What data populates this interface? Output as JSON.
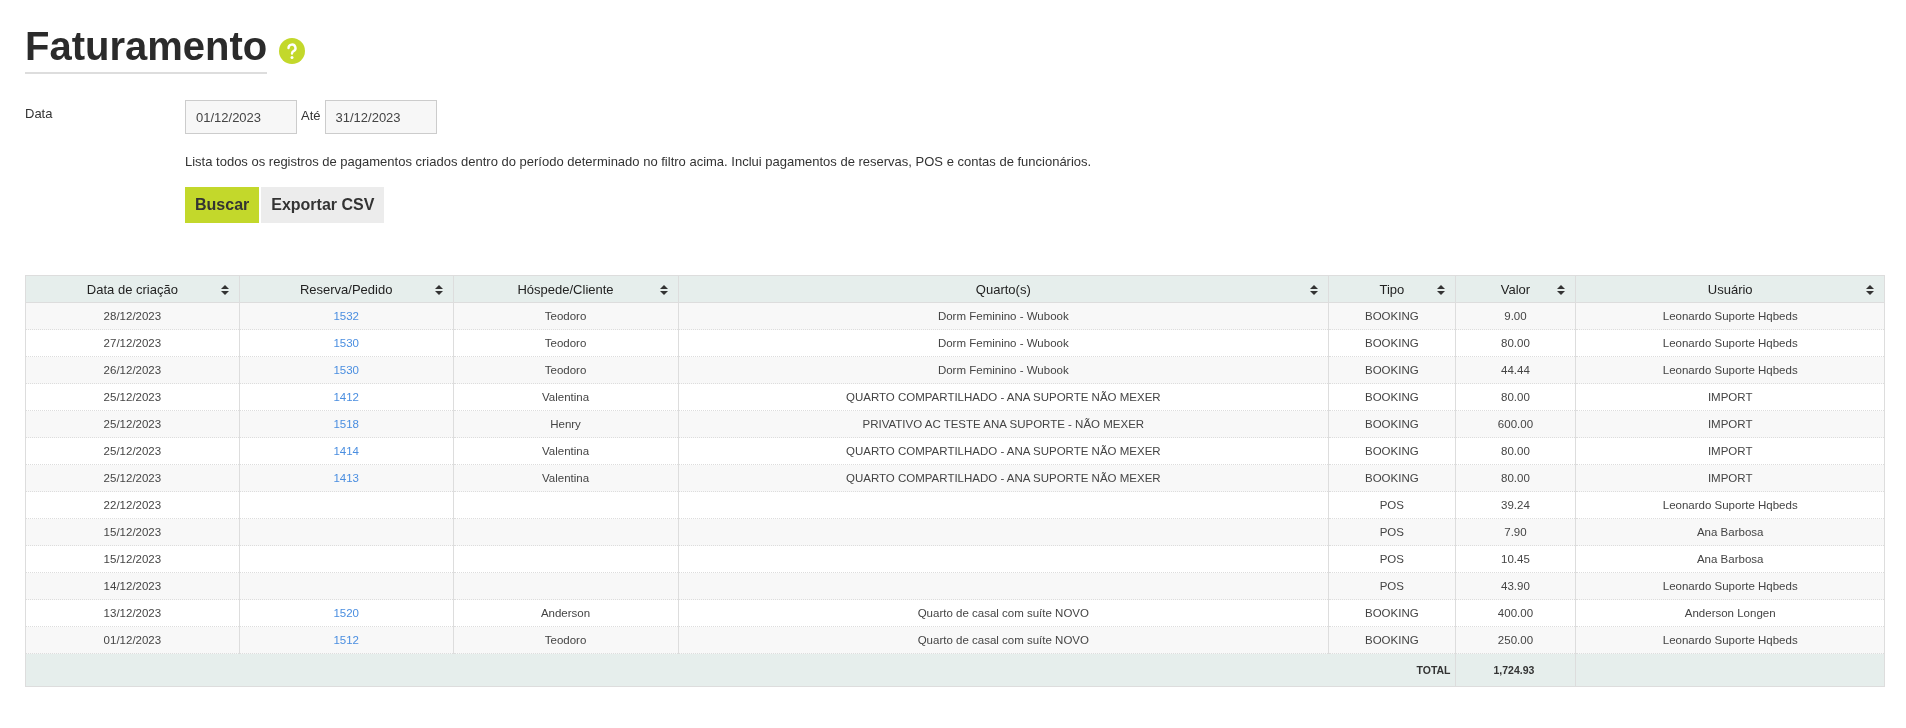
{
  "title": "Faturamento",
  "filter": {
    "label": "Data",
    "from": "01/12/2023",
    "to_label": "Até",
    "to": "31/12/2023"
  },
  "description": "Lista todos os registros de pagamentos criados dentro do período determinado no filtro acima. Inclui pagamentos de reservas, POS e contas de funcionários.",
  "buttons": [
    {
      "label": "Buscar",
      "kind": "primary"
    },
    {
      "label": "Exportar CSV",
      "kind": "secondary"
    }
  ],
  "table": {
    "columns": [
      {
        "label": "Data de criação",
        "sortable": true
      },
      {
        "label": "Reserva/Pedido",
        "sortable": true
      },
      {
        "label": "Hóspede/Cliente",
        "sortable": true
      },
      {
        "label": "Quarto(s)",
        "sortable": true
      },
      {
        "label": "Tipo",
        "sortable": true
      },
      {
        "label": "Valor",
        "sortable": true
      },
      {
        "label": "Usuário",
        "sortable": true
      }
    ],
    "rows": [
      {
        "date": "28/12/2023",
        "order": "1532",
        "guest": "Teodoro",
        "room": "Dorm Feminino - Wubook",
        "type": "BOOKING",
        "value": "9.00",
        "user": "Leonardo Suporte Hqbeds"
      },
      {
        "date": "27/12/2023",
        "order": "1530",
        "guest": "Teodoro",
        "room": "Dorm Feminino - Wubook",
        "type": "BOOKING",
        "value": "80.00",
        "user": "Leonardo Suporte Hqbeds"
      },
      {
        "date": "26/12/2023",
        "order": "1530",
        "guest": "Teodoro",
        "room": "Dorm Feminino - Wubook",
        "type": "BOOKING",
        "value": "44.44",
        "user": "Leonardo Suporte Hqbeds"
      },
      {
        "date": "25/12/2023",
        "order": "1412",
        "guest": "Valentina",
        "room": "QUARTO COMPARTILHADO - ANA SUPORTE NÃO MEXER",
        "type": "BOOKING",
        "value": "80.00",
        "user": "IMPORT"
      },
      {
        "date": "25/12/2023",
        "order": "1518",
        "guest": "Henry",
        "room": "PRIVATIVO AC TESTE ANA SUPORTE - NÃO MEXER",
        "type": "BOOKING",
        "value": "600.00",
        "user": "IMPORT"
      },
      {
        "date": "25/12/2023",
        "order": "1414",
        "guest": "Valentina",
        "room": "QUARTO COMPARTILHADO - ANA SUPORTE NÃO MEXER",
        "type": "BOOKING",
        "value": "80.00",
        "user": "IMPORT"
      },
      {
        "date": "25/12/2023",
        "order": "1413",
        "guest": "Valentina",
        "room": "QUARTO COMPARTILHADO - ANA SUPORTE NÃO MEXER",
        "type": "BOOKING",
        "value": "80.00",
        "user": "IMPORT"
      },
      {
        "date": "22/12/2023",
        "type": "POS",
        "value": "39.24",
        "user": "Leonardo Suporte Hqbeds"
      },
      {
        "date": "15/12/2023",
        "type": "POS",
        "value": "7.90",
        "user": "Ana Barbosa"
      },
      {
        "date": "15/12/2023",
        "type": "POS",
        "value": "10.45",
        "user": "Ana Barbosa"
      },
      {
        "date": "14/12/2023",
        "type": "POS",
        "value": "43.90",
        "user": "Leonardo Suporte Hqbeds"
      },
      {
        "date": "13/12/2023",
        "order": "1520",
        "guest": "Anderson",
        "room": "Quarto de casal com suíte NOVO",
        "type": "BOOKING",
        "value": "400.00",
        "user": "Anderson Longen"
      },
      {
        "date": "01/12/2023",
        "order": "1512",
        "guest": "Teodoro",
        "room": "Quarto de casal com suíte NOVO",
        "type": "BOOKING",
        "value": "250.00",
        "user": "Leonardo Suporte Hqbeds"
      }
    ],
    "total": {
      "label": "TOTAL",
      "value": "1,724.93"
    }
  }
}
